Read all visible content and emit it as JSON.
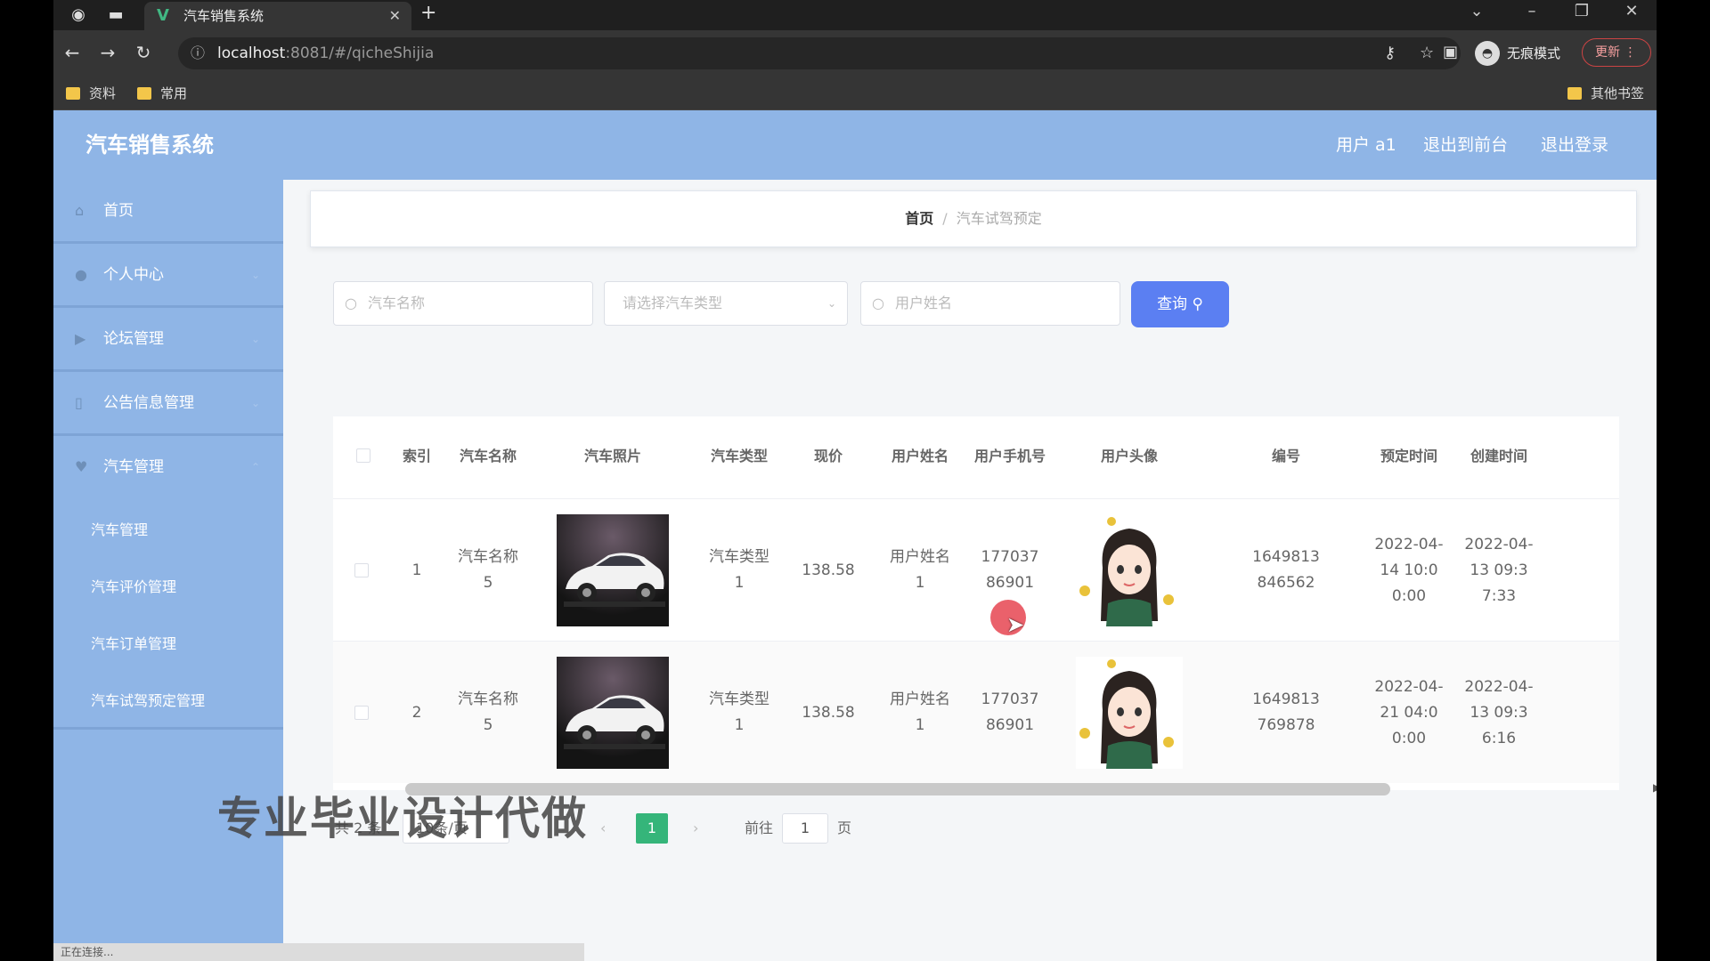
{
  "browser": {
    "tab_title": "汽车销售系统",
    "url_host": "localhost",
    "url_port_path": ":8081/#/qicheShijia",
    "incognito_label": "无痕模式",
    "update_label": "更新",
    "bookmarks": [
      "资料",
      "常用"
    ],
    "other_bookmarks": "其他书签"
  },
  "header": {
    "title": "汽车销售系统",
    "user_label": "用户 a1",
    "to_front_label": "退出到前台",
    "logout_label": "退出登录"
  },
  "sidebar": {
    "items": [
      {
        "label": "首页",
        "icon": "home-icon"
      },
      {
        "label": "个人中心",
        "icon": "user-icon"
      },
      {
        "label": "论坛管理",
        "icon": "forum-icon"
      },
      {
        "label": "公告信息管理",
        "icon": "notice-icon"
      },
      {
        "label": "汽车管理",
        "icon": "car-icon"
      }
    ],
    "sub_items": [
      "汽车管理",
      "汽车评价管理",
      "汽车订单管理",
      "汽车试驾预定管理"
    ]
  },
  "breadcrumb": {
    "home": "首页",
    "separator": "/",
    "current": "汽车试驾预定"
  },
  "search": {
    "car_name_placeholder": "汽车名称",
    "car_type_placeholder": "请选择汽车类型",
    "user_name_placeholder": "用户姓名",
    "query_label": "查询"
  },
  "table": {
    "headers": [
      "索引",
      "汽车名称",
      "汽车照片",
      "汽车类型",
      "现价",
      "用户姓名",
      "用户手机号",
      "用户头像",
      "编号",
      "预定时间",
      "创建时间"
    ],
    "rows": [
      {
        "index": "1",
        "car_name": "汽车名称5",
        "car_type": "汽车类型1",
        "price": "138.58",
        "user_name": "用户姓名1",
        "phone": "17703786901",
        "number": "1649813846562",
        "reserve_time": "2022-04-14 10:00:00",
        "create_time": "2022-04-13 09:37:33"
      },
      {
        "index": "2",
        "car_name": "汽车名称5",
        "car_type": "汽车类型1",
        "price": "138.58",
        "user_name": "用户姓名1",
        "phone": "17703786901",
        "number": "1649813769878",
        "reserve_time": "2022-04-21 04:00:00",
        "create_time": "2022-04-13 09:36:16"
      }
    ]
  },
  "pagination": {
    "total": "共 2 条",
    "page_size": "10条/页",
    "current_page": "1",
    "goto_label": "前往",
    "goto_value": "1",
    "page_unit": "页"
  },
  "overlay": {
    "watermark": "专业毕业设计代做",
    "status": "正在连接..."
  }
}
